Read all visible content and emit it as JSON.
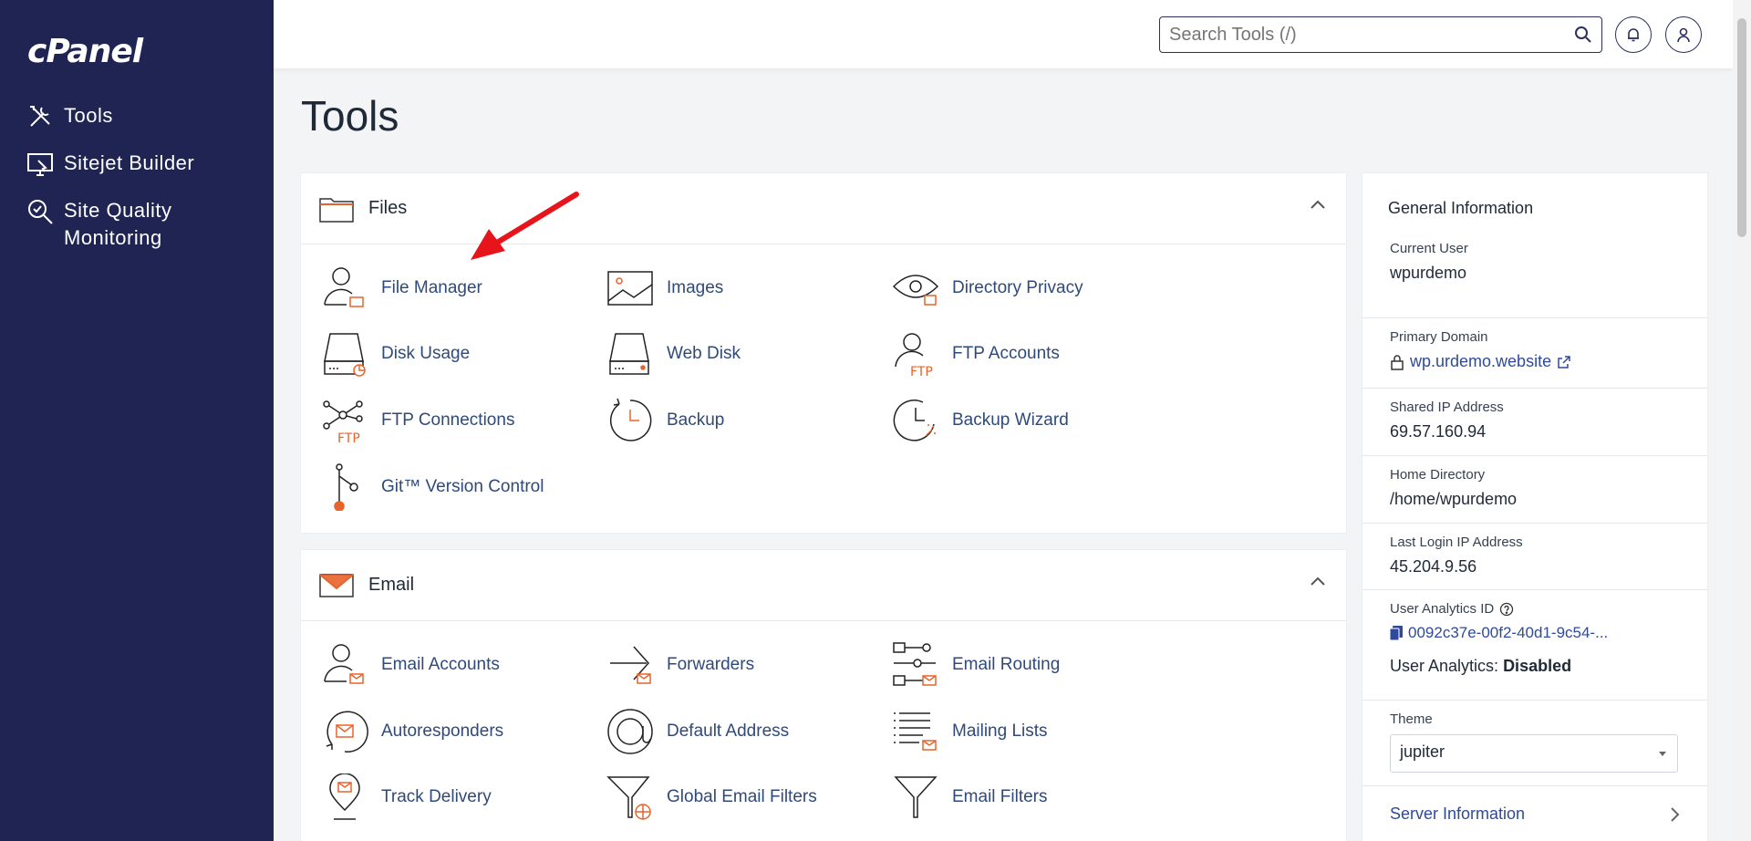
{
  "sidebar": {
    "logo": "cPanel",
    "items": [
      {
        "label": "Tools",
        "icon": "tools-icon"
      },
      {
        "label": "Sitejet Builder",
        "icon": "monitor-icon"
      },
      {
        "label": "Site Quality Monitoring",
        "icon": "magnify-check-icon"
      }
    ]
  },
  "topbar": {
    "search_placeholder": "Search Tools (/)"
  },
  "page_title": "Tools",
  "files": {
    "title": "Files",
    "tools": [
      {
        "label": "File Manager",
        "icon": "file-manager-icon"
      },
      {
        "label": "Images",
        "icon": "image-icon"
      },
      {
        "label": "Directory Privacy",
        "icon": "eye-folder-icon"
      },
      {
        "label": "Disk Usage",
        "icon": "disk-usage-icon"
      },
      {
        "label": "Web Disk",
        "icon": "web-disk-icon"
      },
      {
        "label": "FTP Accounts",
        "icon": "ftp-accounts-icon"
      },
      {
        "label": "FTP Connections",
        "icon": "ftp-connections-icon"
      },
      {
        "label": "Backup",
        "icon": "backup-icon"
      },
      {
        "label": "Backup Wizard",
        "icon": "backup-wizard-icon"
      },
      {
        "label": "Git™ Version Control",
        "icon": "git-icon"
      }
    ]
  },
  "email": {
    "title": "Email",
    "tools": [
      {
        "label": "Email Accounts",
        "icon": "email-accounts-icon"
      },
      {
        "label": "Forwarders",
        "icon": "forwarders-icon"
      },
      {
        "label": "Email Routing",
        "icon": "email-routing-icon"
      },
      {
        "label": "Autoresponders",
        "icon": "autoresponders-icon"
      },
      {
        "label": "Default Address",
        "icon": "at-sign-icon"
      },
      {
        "label": "Mailing Lists",
        "icon": "mailing-lists-icon"
      },
      {
        "label": "Track Delivery",
        "icon": "track-delivery-icon"
      },
      {
        "label": "Global Email Filters",
        "icon": "global-filter-icon"
      },
      {
        "label": "Email Filters",
        "icon": "filter-icon"
      }
    ]
  },
  "info": {
    "title": "General Information",
    "current_user_label": "Current User",
    "current_user": "wpurdemo",
    "primary_domain_label": "Primary Domain",
    "primary_domain": "wp.urdemo.website",
    "shared_ip_label": "Shared IP Address",
    "shared_ip": "69.57.160.94",
    "home_dir_label": "Home Directory",
    "home_dir": "/home/wpurdemo",
    "last_login_label": "Last Login IP Address",
    "last_login": "45.204.9.56",
    "analytics_id_label": "User Analytics ID",
    "analytics_id": "0092c37e-00f2-40d1-9c54-...",
    "analytics_status_label": "User Analytics:",
    "analytics_status": "Disabled",
    "theme_label": "Theme",
    "theme_value": "jupiter",
    "server_info": "Server Information"
  },
  "colors": {
    "sidebar": "#1f2452",
    "accent_orange": "#e8632b",
    "link_blue": "#2f4a7a",
    "annotation_arrow": "#e8141b"
  }
}
